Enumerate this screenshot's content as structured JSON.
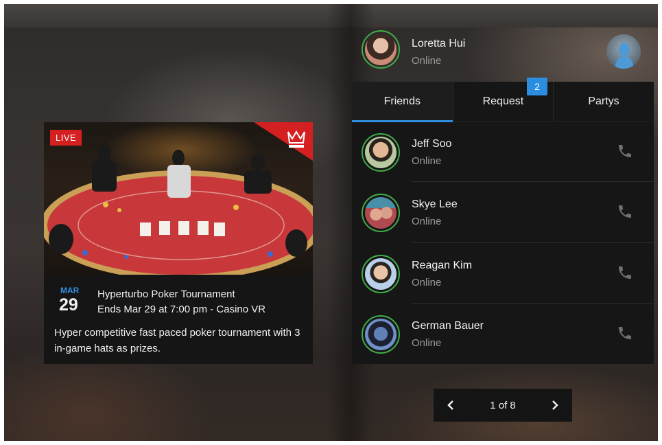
{
  "event": {
    "live_label": "LIVE",
    "month": "MAR",
    "day": "29",
    "title": "Hyperturbo Poker Tournament",
    "subtitle": "Ends Mar 29 at 7:00 pm - Casino VR",
    "description": "Hyper competitive fast paced poker tournament with 3 in-game hats as prizes."
  },
  "profile": {
    "name": "Loretta Hui",
    "status": "Online"
  },
  "tabs": [
    {
      "label": "Friends",
      "active": true
    },
    {
      "label": "Request",
      "badge": "2"
    },
    {
      "label": "Partys"
    }
  ],
  "friends": [
    {
      "name": "Jeff Soo",
      "status": "Online"
    },
    {
      "name": "Skye Lee",
      "status": "Online"
    },
    {
      "name": "Reagan Kim",
      "status": "Online"
    },
    {
      "name": "German Bauer",
      "status": "Online"
    }
  ],
  "pager": {
    "label": "1 of 8"
  },
  "colors": {
    "accent": "#2f8ee0",
    "online_ring": "#3fae48",
    "live": "#d42020"
  },
  "icons": [
    "phone-icon",
    "chevron-left-icon",
    "chevron-right-icon",
    "crown-icon"
  ]
}
